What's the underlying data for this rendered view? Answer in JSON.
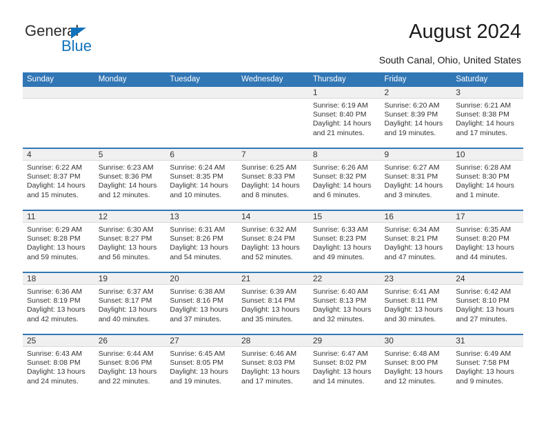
{
  "brand": {
    "name_part1": "General",
    "name_part2": "Blue",
    "accent_color": "#1072bb"
  },
  "header": {
    "title": "August 2024",
    "subtitle": "South Canal, Ohio, United States",
    "header_bg_color": "#3176b5"
  },
  "weekday_headers": [
    "Sunday",
    "Monday",
    "Tuesday",
    "Wednesday",
    "Thursday",
    "Friday",
    "Saturday"
  ],
  "labels": {
    "sunrise_prefix": "Sunrise:",
    "sunset_prefix": "Sunset:",
    "daylight_prefix": "Daylight:"
  },
  "weeks": [
    [
      {
        "day": "",
        "blank": true
      },
      {
        "day": "",
        "blank": true
      },
      {
        "day": "",
        "blank": true
      },
      {
        "day": "",
        "blank": true
      },
      {
        "day": "1",
        "sunrise": "Sunrise: 6:19 AM",
        "sunset": "Sunset: 8:40 PM",
        "daylight": "Daylight: 14 hours and 21 minutes."
      },
      {
        "day": "2",
        "sunrise": "Sunrise: 6:20 AM",
        "sunset": "Sunset: 8:39 PM",
        "daylight": "Daylight: 14 hours and 19 minutes."
      },
      {
        "day": "3",
        "sunrise": "Sunrise: 6:21 AM",
        "sunset": "Sunset: 8:38 PM",
        "daylight": "Daylight: 14 hours and 17 minutes."
      }
    ],
    [
      {
        "day": "4",
        "sunrise": "Sunrise: 6:22 AM",
        "sunset": "Sunset: 8:37 PM",
        "daylight": "Daylight: 14 hours and 15 minutes."
      },
      {
        "day": "5",
        "sunrise": "Sunrise: 6:23 AM",
        "sunset": "Sunset: 8:36 PM",
        "daylight": "Daylight: 14 hours and 12 minutes."
      },
      {
        "day": "6",
        "sunrise": "Sunrise: 6:24 AM",
        "sunset": "Sunset: 8:35 PM",
        "daylight": "Daylight: 14 hours and 10 minutes."
      },
      {
        "day": "7",
        "sunrise": "Sunrise: 6:25 AM",
        "sunset": "Sunset: 8:33 PM",
        "daylight": "Daylight: 14 hours and 8 minutes."
      },
      {
        "day": "8",
        "sunrise": "Sunrise: 6:26 AM",
        "sunset": "Sunset: 8:32 PM",
        "daylight": "Daylight: 14 hours and 6 minutes."
      },
      {
        "day": "9",
        "sunrise": "Sunrise: 6:27 AM",
        "sunset": "Sunset: 8:31 PM",
        "daylight": "Daylight: 14 hours and 3 minutes."
      },
      {
        "day": "10",
        "sunrise": "Sunrise: 6:28 AM",
        "sunset": "Sunset: 8:30 PM",
        "daylight": "Daylight: 14 hours and 1 minute."
      }
    ],
    [
      {
        "day": "11",
        "sunrise": "Sunrise: 6:29 AM",
        "sunset": "Sunset: 8:28 PM",
        "daylight": "Daylight: 13 hours and 59 minutes."
      },
      {
        "day": "12",
        "sunrise": "Sunrise: 6:30 AM",
        "sunset": "Sunset: 8:27 PM",
        "daylight": "Daylight: 13 hours and 56 minutes."
      },
      {
        "day": "13",
        "sunrise": "Sunrise: 6:31 AM",
        "sunset": "Sunset: 8:26 PM",
        "daylight": "Daylight: 13 hours and 54 minutes."
      },
      {
        "day": "14",
        "sunrise": "Sunrise: 6:32 AM",
        "sunset": "Sunset: 8:24 PM",
        "daylight": "Daylight: 13 hours and 52 minutes."
      },
      {
        "day": "15",
        "sunrise": "Sunrise: 6:33 AM",
        "sunset": "Sunset: 8:23 PM",
        "daylight": "Daylight: 13 hours and 49 minutes."
      },
      {
        "day": "16",
        "sunrise": "Sunrise: 6:34 AM",
        "sunset": "Sunset: 8:21 PM",
        "daylight": "Daylight: 13 hours and 47 minutes."
      },
      {
        "day": "17",
        "sunrise": "Sunrise: 6:35 AM",
        "sunset": "Sunset: 8:20 PM",
        "daylight": "Daylight: 13 hours and 44 minutes."
      }
    ],
    [
      {
        "day": "18",
        "sunrise": "Sunrise: 6:36 AM",
        "sunset": "Sunset: 8:19 PM",
        "daylight": "Daylight: 13 hours and 42 minutes."
      },
      {
        "day": "19",
        "sunrise": "Sunrise: 6:37 AM",
        "sunset": "Sunset: 8:17 PM",
        "daylight": "Daylight: 13 hours and 40 minutes."
      },
      {
        "day": "20",
        "sunrise": "Sunrise: 6:38 AM",
        "sunset": "Sunset: 8:16 PM",
        "daylight": "Daylight: 13 hours and 37 minutes."
      },
      {
        "day": "21",
        "sunrise": "Sunrise: 6:39 AM",
        "sunset": "Sunset: 8:14 PM",
        "daylight": "Daylight: 13 hours and 35 minutes."
      },
      {
        "day": "22",
        "sunrise": "Sunrise: 6:40 AM",
        "sunset": "Sunset: 8:13 PM",
        "daylight": "Daylight: 13 hours and 32 minutes."
      },
      {
        "day": "23",
        "sunrise": "Sunrise: 6:41 AM",
        "sunset": "Sunset: 8:11 PM",
        "daylight": "Daylight: 13 hours and 30 minutes."
      },
      {
        "day": "24",
        "sunrise": "Sunrise: 6:42 AM",
        "sunset": "Sunset: 8:10 PM",
        "daylight": "Daylight: 13 hours and 27 minutes."
      }
    ],
    [
      {
        "day": "25",
        "sunrise": "Sunrise: 6:43 AM",
        "sunset": "Sunset: 8:08 PM",
        "daylight": "Daylight: 13 hours and 24 minutes."
      },
      {
        "day": "26",
        "sunrise": "Sunrise: 6:44 AM",
        "sunset": "Sunset: 8:06 PM",
        "daylight": "Daylight: 13 hours and 22 minutes."
      },
      {
        "day": "27",
        "sunrise": "Sunrise: 6:45 AM",
        "sunset": "Sunset: 8:05 PM",
        "daylight": "Daylight: 13 hours and 19 minutes."
      },
      {
        "day": "28",
        "sunrise": "Sunrise: 6:46 AM",
        "sunset": "Sunset: 8:03 PM",
        "daylight": "Daylight: 13 hours and 17 minutes."
      },
      {
        "day": "29",
        "sunrise": "Sunrise: 6:47 AM",
        "sunset": "Sunset: 8:02 PM",
        "daylight": "Daylight: 13 hours and 14 minutes."
      },
      {
        "day": "30",
        "sunrise": "Sunrise: 6:48 AM",
        "sunset": "Sunset: 8:00 PM",
        "daylight": "Daylight: 13 hours and 12 minutes."
      },
      {
        "day": "31",
        "sunrise": "Sunrise: 6:49 AM",
        "sunset": "Sunset: 7:58 PM",
        "daylight": "Daylight: 13 hours and 9 minutes."
      }
    ]
  ]
}
